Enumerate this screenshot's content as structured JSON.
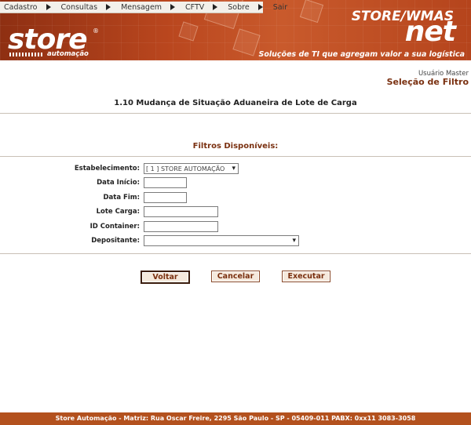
{
  "menu": {
    "items": [
      {
        "label": "Cadastro"
      },
      {
        "label": "Consultas"
      },
      {
        "label": "Mensagem"
      },
      {
        "label": "CFTV"
      },
      {
        "label": "Sobre"
      },
      {
        "label": "Sair"
      }
    ]
  },
  "brand": {
    "logo_text": "store",
    "logo_sub": "automação",
    "product_title": "STORE/WMAS",
    "product_net": "net",
    "tagline": "Soluções de TI que agregam valor a sua logística"
  },
  "user": {
    "label": "Usuário Master",
    "page_subtitle": "Seleção de Filtro"
  },
  "page": {
    "title": "1.10 Mudança de Situação Aduaneira de Lote de Carga",
    "filters_heading": "Filtros Disponíveis:"
  },
  "form": {
    "estabelecimento": {
      "label": "Estabelecimento:",
      "value": "[ 1 ] STORE AUTOMAÇÃO"
    },
    "data_inicio": {
      "label": "Data Início:",
      "value": ""
    },
    "data_fim": {
      "label": "Data Fim:",
      "value": ""
    },
    "lote_carga": {
      "label": "Lote Carga:",
      "value": ""
    },
    "id_container": {
      "label": "ID Container:",
      "value": ""
    },
    "depositante": {
      "label": "Depositante:",
      "value": ""
    }
  },
  "buttons": {
    "voltar": "Voltar",
    "cancelar": "Cancelar",
    "executar": "Executar"
  },
  "footer": {
    "text": "Store Automação - Matriz: Rua Oscar Freire, 2295 São Paulo - SP - 05409-011 PABX: 0xx11 3083-3058"
  },
  "colors": {
    "brand_orange": "#b3511e",
    "heading_brown": "#7a3010"
  }
}
